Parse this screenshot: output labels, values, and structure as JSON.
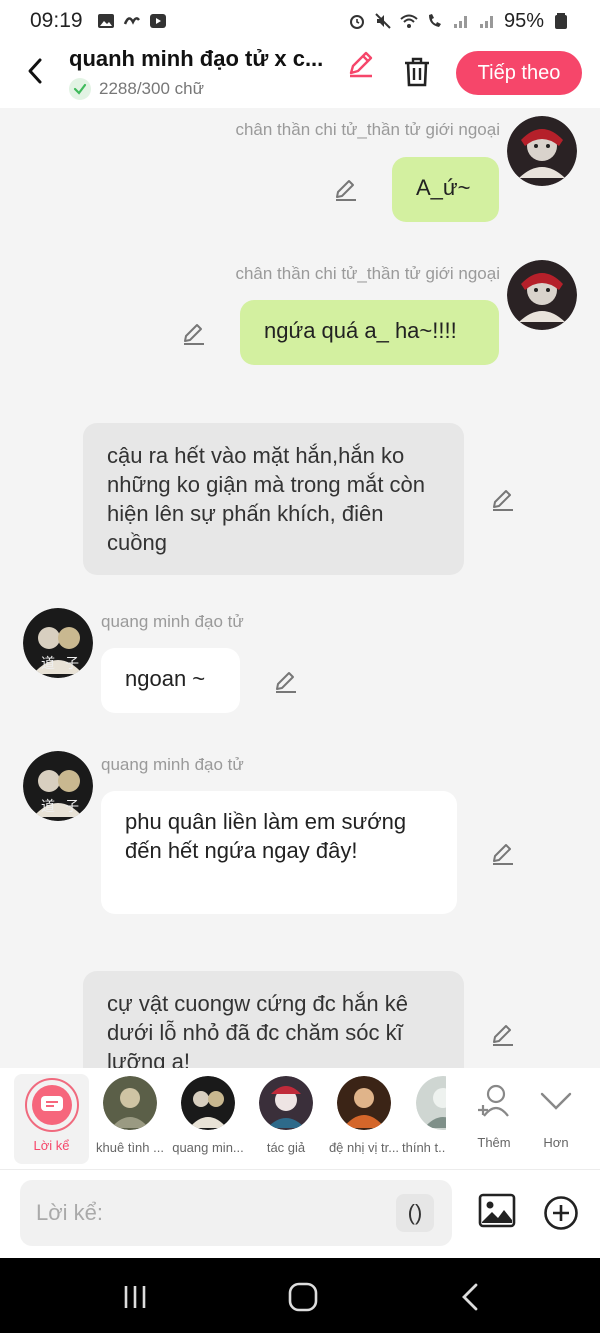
{
  "status_bar": {
    "time": "09:19",
    "battery": "95%"
  },
  "header": {
    "title": "quanh minh đạo tử x c...",
    "word_count": "2288/300 chữ",
    "next_label": "Tiếp theo"
  },
  "messages": [
    {
      "sender": "chân thần chi tử_thần tử giới ngoại",
      "text": "A_ứ~",
      "side": "right",
      "style": "green"
    },
    {
      "sender": "chân thần chi tử_thần tử giới ngoại",
      "text": "ngứa quá a_ ha~!!!!",
      "side": "right",
      "style": "green"
    },
    {
      "sender": "",
      "text": "cậu ra hết vào mặt hắn,hắn ko những ko giận mà trong mắt còn hiện lên sự phấn khích, điên cuồng",
      "side": "narration",
      "style": "gray"
    },
    {
      "sender": "quang minh đạo tử",
      "text": "ngoan ~",
      "side": "left",
      "style": "white"
    },
    {
      "sender": "quang minh đạo tử",
      "text": "phu quân liền làm em sướng đến hết ngứa ngay đây!",
      "side": "left",
      "style": "white"
    },
    {
      "sender": "",
      "text": "cự vật cuongw cứng đc hắn kê dưới lỗ nhỏ đã đc chăm sóc kĩ lưỡng a!",
      "side": "narration",
      "style": "gray"
    }
  ],
  "characters": {
    "narrator_label": "Lời kể",
    "items": [
      {
        "label": "khuê tình ..."
      },
      {
        "label": "quang min..."
      },
      {
        "label": "tác giả"
      },
      {
        "label": "đệ nhị vị tr..."
      },
      {
        "label": "thính t..."
      }
    ],
    "add_label": "Thêm",
    "more_label": "Hơn"
  },
  "input": {
    "placeholder": "Lời kể:",
    "paren_label": "()"
  },
  "colors": {
    "accent": "#f6466a",
    "green_bubble": "#d3f0a0",
    "narration_bubble": "#e7e7e7"
  }
}
